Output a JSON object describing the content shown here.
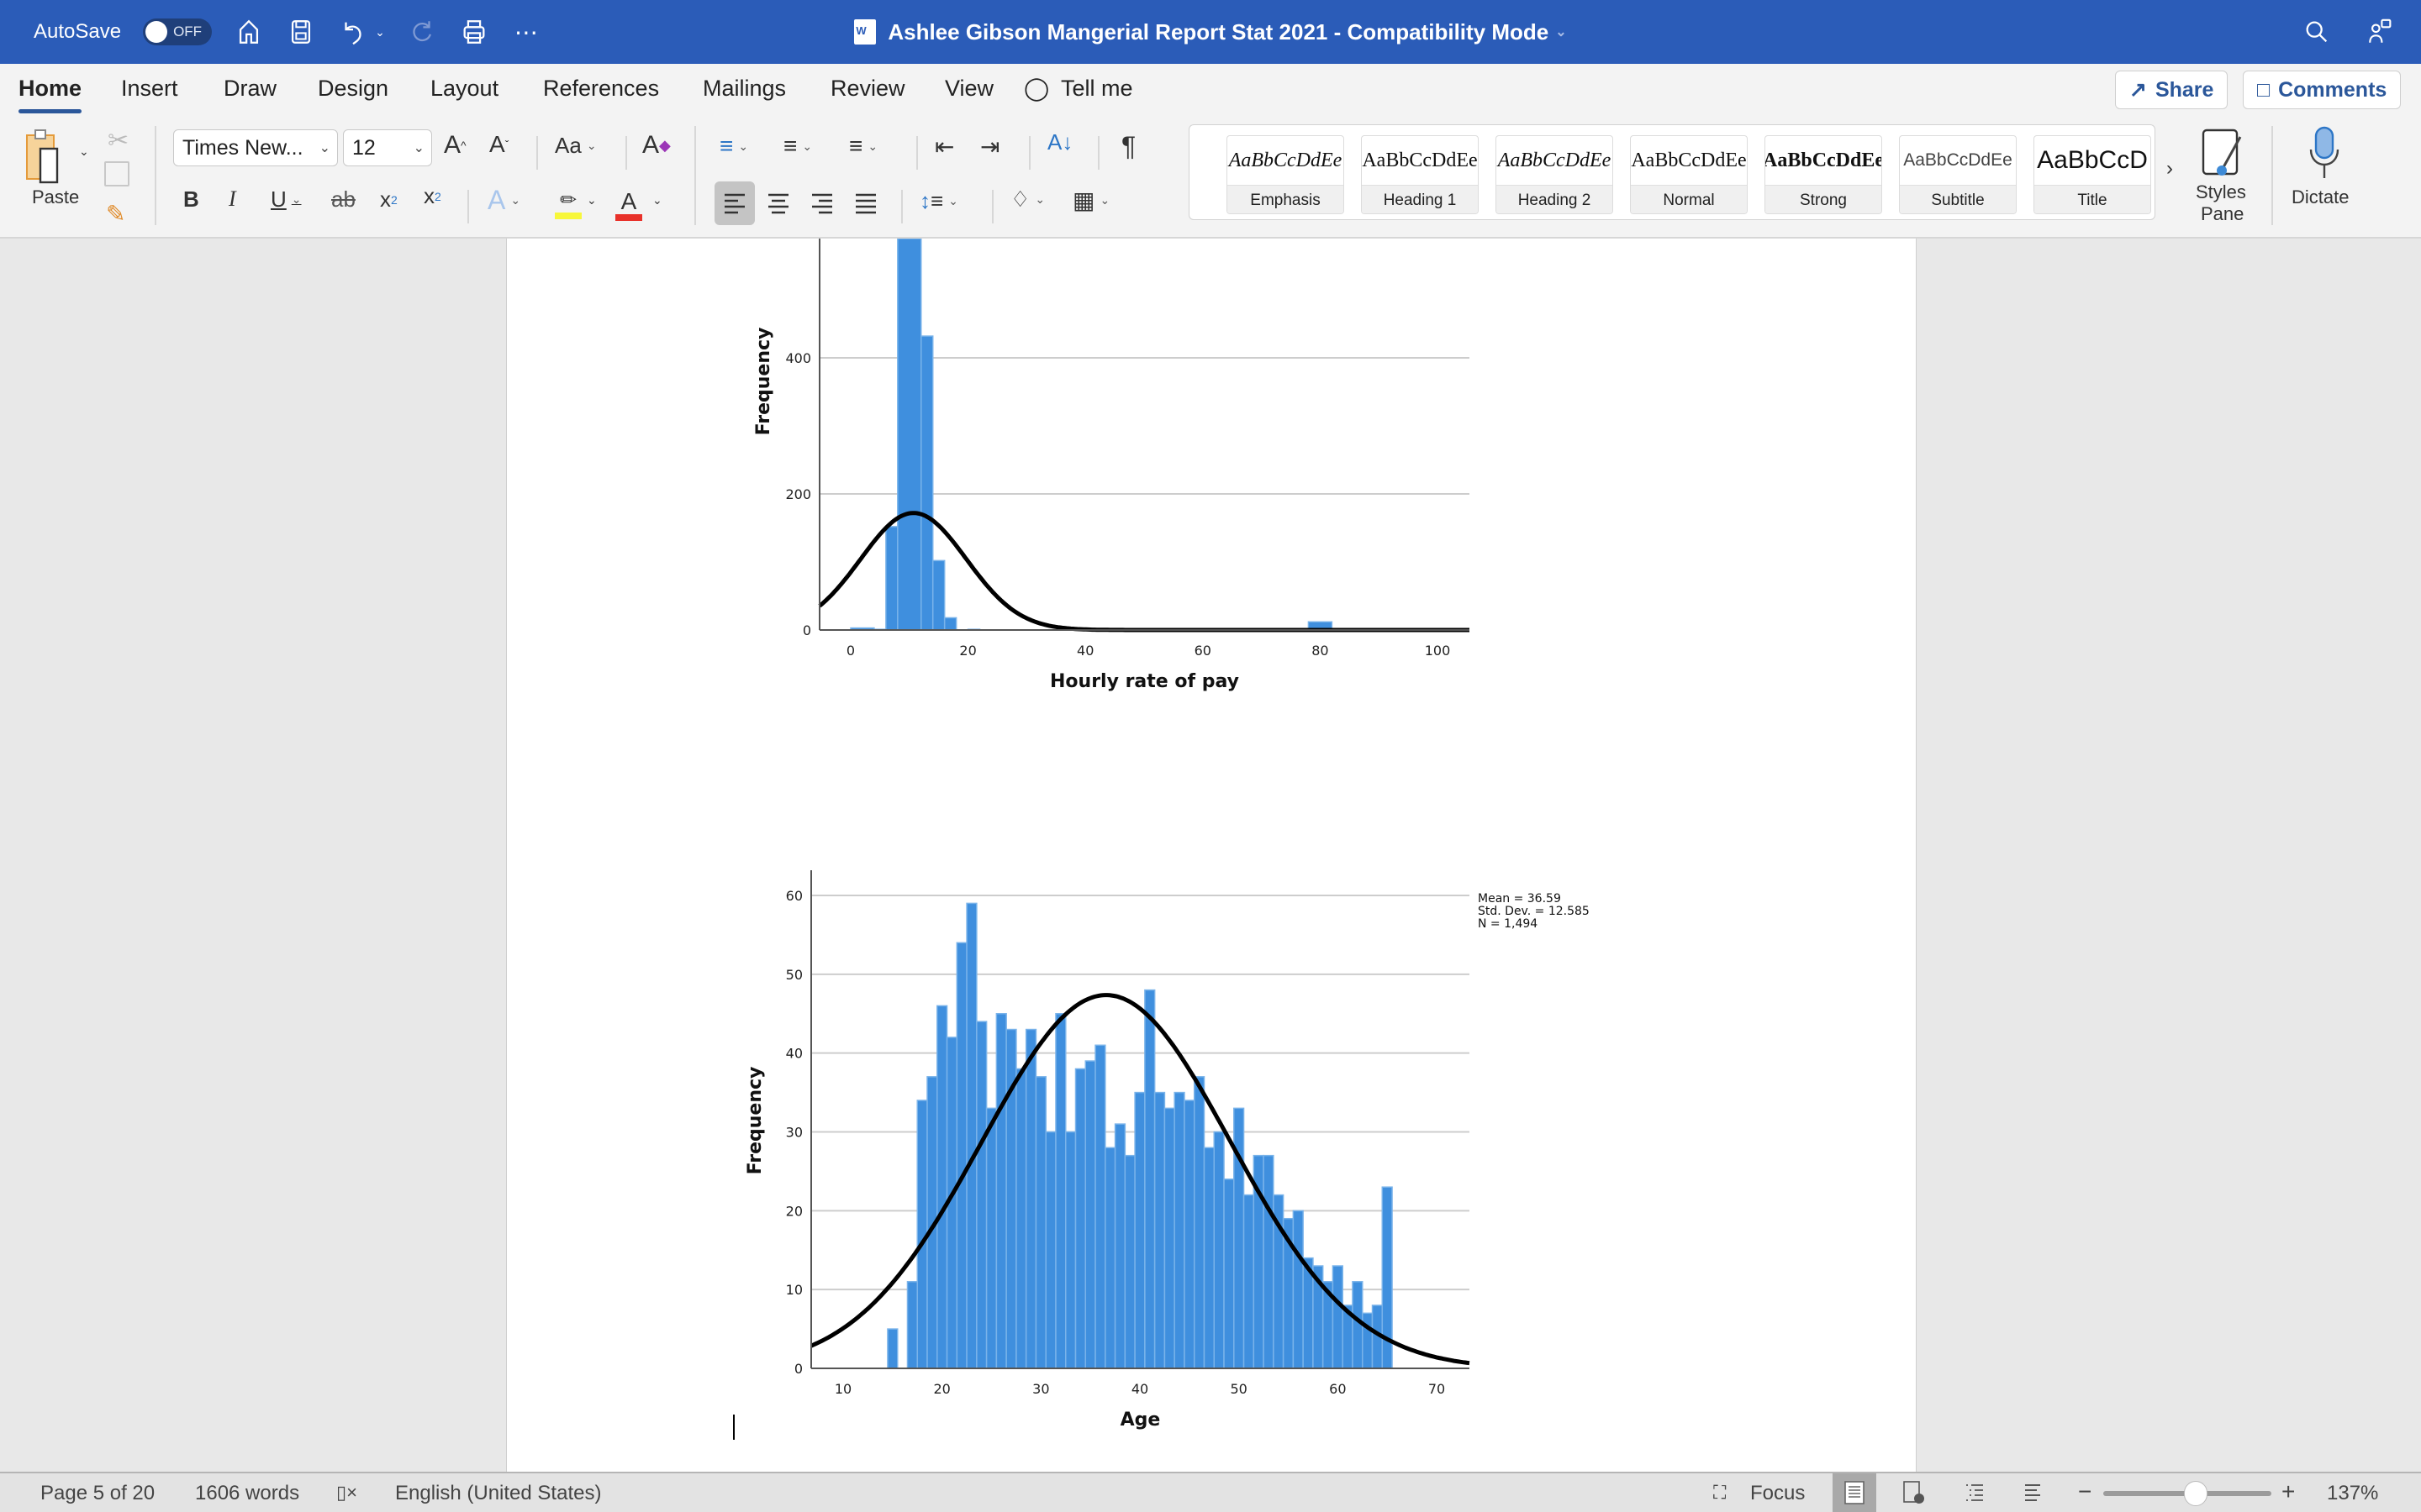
{
  "titlebar": {
    "autosave_label": "AutoSave",
    "autosave_state": "OFF",
    "document_title": "Ashlee Gibson Mangerial Report Stat 2021  -  Compatibility Mode"
  },
  "tabs": [
    {
      "label": "Home",
      "active": true
    },
    {
      "label": "Insert"
    },
    {
      "label": "Draw"
    },
    {
      "label": "Design"
    },
    {
      "label": "Layout"
    },
    {
      "label": "References"
    },
    {
      "label": "Mailings"
    },
    {
      "label": "Review"
    },
    {
      "label": "View"
    },
    {
      "label": "Tell me"
    }
  ],
  "share_label": "Share",
  "comments_label": "Comments",
  "ribbon": {
    "paste_label": "Paste",
    "font_name": "Times New...",
    "font_size": "12",
    "change_case_label": "Aa",
    "styles": [
      {
        "preview": "AaBbCcDdEe",
        "label": "Emphasis"
      },
      {
        "preview": "AaBbCcDdEe",
        "label": "Heading 1"
      },
      {
        "preview": "AaBbCcDdEe",
        "label": "Heading 2"
      },
      {
        "preview": "AaBbCcDdEe",
        "label": "Normal"
      },
      {
        "preview": "AaBbCcDdEe",
        "label": "Strong"
      },
      {
        "preview": "AaBbCcDdEe",
        "label": "Subtitle"
      },
      {
        "preview": "AaBbCcD",
        "label": "Title"
      }
    ],
    "styles_pane_label_1": "Styles",
    "styles_pane_label_2": "Pane",
    "dictate_label": "Dictate",
    "highlight_color": "#f7f73a",
    "font_color": "#e8312a"
  },
  "statusbar": {
    "page": "Page 5 of 20",
    "words": "1606 words",
    "language": "English (United States)",
    "focus_label": "Focus",
    "zoom_level": "137%",
    "zoom_fraction": 0.55
  },
  "chart_data": [
    {
      "type": "bar",
      "title": "",
      "xlabel": "Hourly rate of pay",
      "ylabel": "Frequency",
      "xlim": [
        -5,
        105
      ],
      "ylim": [
        0,
        540
      ],
      "yticks": [
        0,
        200,
        400
      ],
      "xticks": [
        0,
        20,
        40,
        60,
        80,
        100
      ],
      "grid": true,
      "bin_width": 4,
      "bins": [
        {
          "x": 0,
          "value": 3
        },
        {
          "x": 4,
          "value": 1
        },
        {
          "x": 6,
          "value": 152
        },
        {
          "x": 8,
          "value": 600
        },
        {
          "x": 12,
          "value": 432
        },
        {
          "x": 14,
          "value": 102
        },
        {
          "x": 16,
          "value": 18
        },
        {
          "x": 20,
          "value": 1
        },
        {
          "x": 80,
          "value": 12
        },
        {
          "x": 88,
          "value": 2
        }
      ],
      "bin_starts": [
        0,
        4,
        6,
        8,
        12,
        14,
        16,
        20,
        78,
        86
      ],
      "normal_curve": {
        "mean": 10.7,
        "sd": 9.0,
        "peak": 172
      },
      "stats_note": "top of chart (legend) is cut off above visible area"
    },
    {
      "type": "bar",
      "title": "",
      "xlabel": "Age",
      "ylabel": "Frequency",
      "xlim": [
        7,
        73
      ],
      "ylim": [
        0,
        62
      ],
      "yticks": [
        0,
        10,
        20,
        30,
        40,
        50,
        60
      ],
      "xticks": [
        10,
        20,
        30,
        40,
        50,
        60,
        70
      ],
      "grid": true,
      "legend": "top-right",
      "stats": [
        "Mean = 36.59",
        "Std. Dev. = 12.585",
        "N = 1,494"
      ],
      "categories": [
        15,
        16,
        17,
        18,
        19,
        20,
        21,
        22,
        23,
        24,
        25,
        26,
        27,
        28,
        29,
        30,
        31,
        32,
        33,
        34,
        35,
        36,
        37,
        38,
        39,
        40,
        41,
        42,
        43,
        44,
        45,
        46,
        47,
        48,
        49,
        50,
        51,
        52,
        53,
        54,
        55,
        56,
        57,
        58,
        59,
        60,
        61,
        62,
        63,
        64,
        65
      ],
      "values": [
        5,
        0,
        11,
        34,
        37,
        46,
        42,
        54,
        59,
        44,
        33,
        45,
        43,
        38,
        43,
        37,
        30,
        45,
        30,
        38,
        39,
        41,
        28,
        31,
        27,
        35,
        48,
        35,
        33,
        35,
        34,
        37,
        28,
        30,
        24,
        33,
        22,
        27,
        27,
        22,
        19,
        20,
        14,
        13,
        11,
        13,
        8,
        11,
        7,
        8,
        23
      ],
      "normal_curve": {
        "mean": 36.59,
        "sd": 12.585,
        "n": 1494
      }
    }
  ]
}
